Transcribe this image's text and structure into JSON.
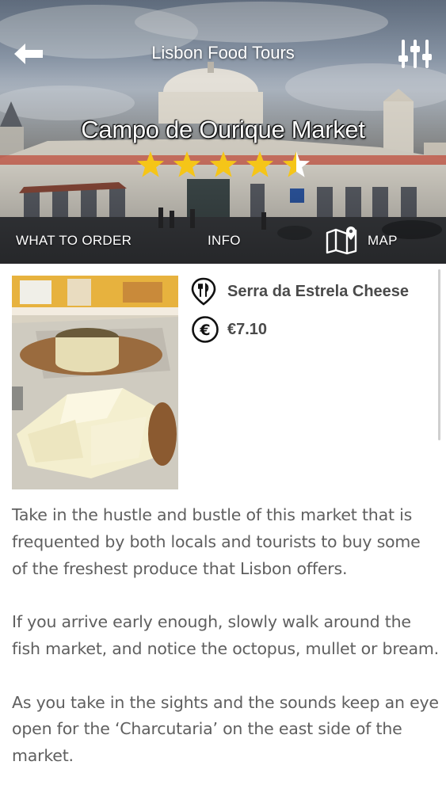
{
  "header": {
    "title": "Lisbon Food Tours",
    "back_icon": "arrow-left-icon",
    "filter_icon": "sliders-icon"
  },
  "hero": {
    "market_name": "Campo de Ourique Market",
    "rating": 4.5,
    "rating_max": 5,
    "star_color": "#f5c518"
  },
  "tabs": {
    "order": "WHAT TO ORDER",
    "info": "INFO",
    "map": "MAP",
    "map_icon": "folded-map-pin-icon"
  },
  "item": {
    "name": "Serra da Estrela Cheese",
    "price": "€7.10",
    "name_icon": "fork-knife-pin-icon",
    "price_icon": "euro-circle-icon"
  },
  "description": [
    "Take in the hustle and bustle of this market that is frequented by both locals and tourists to buy some of the freshest produce that Lisbon offers.",
    "If you arrive early enough, slowly walk around the fish market, and notice the octopus, mullet or bream.",
    "As you take in the sights and the sounds keep an eye open for the ‘Charcutaria’ on the east side of the market."
  ]
}
